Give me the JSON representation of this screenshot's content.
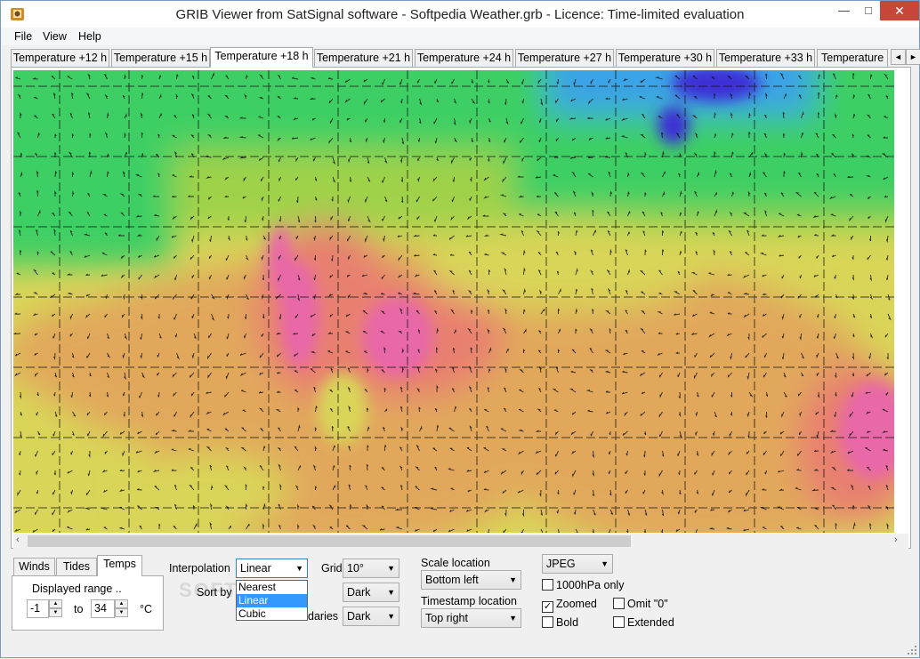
{
  "window": {
    "title": "GRIB Viewer from SatSignal software - Softpedia Weather.grb - Licence: Time-limited evaluation",
    "min_symbol": "—",
    "max_symbol": "□",
    "close_symbol": "✕"
  },
  "menu": [
    "File",
    "View",
    "Help"
  ],
  "tabs": {
    "items": [
      "Temperature +12 h",
      "Temperature +15 h",
      "Temperature +18 h",
      "Temperature +21 h",
      "Temperature +24 h",
      "Temperature +27 h",
      "Temperature +30 h",
      "Temperature +33 h",
      "Temperature"
    ],
    "active_index": 2,
    "scroll_left": "◄",
    "scroll_right": "►"
  },
  "map": {
    "description_icons": "temperature-map with wind-arrows and lat-lon grid",
    "colors": {
      "cold_deep": "#3e2dd6",
      "cold": "#3aa2e8",
      "cool": "#3ccf63",
      "mild": "#9fd24a",
      "warm": "#d9d558",
      "warmer": "#e1a85c",
      "hot": "#e88070",
      "hottest": "#e868a8"
    }
  },
  "scrollbar": {
    "left_arrow": "‹",
    "right_arrow": "›"
  },
  "bottom_tabs": {
    "items": [
      "Winds",
      "Tides",
      "Temps"
    ],
    "active_index": 2
  },
  "temps": {
    "displayed_range_label": "Displayed range ..",
    "from_value": "-1",
    "to_label": "to",
    "to_value": "34",
    "unit": "°C"
  },
  "interpolation": {
    "label": "Interpolation",
    "value": "Linear",
    "options": [
      "Nearest",
      "Linear",
      "Cubic"
    ],
    "selected_index": 1
  },
  "sort_by": {
    "label": "Sort by"
  },
  "grid": {
    "label": "Grid",
    "value": "10°"
  },
  "dark1": {
    "value": "Dark"
  },
  "boundaries": {
    "label": "daries",
    "value": "Dark"
  },
  "scale_location": {
    "label": "Scale location",
    "value": "Bottom left"
  },
  "timestamp_location": {
    "label": "Timestamp location",
    "value": "Top right"
  },
  "format": {
    "value": "JPEG"
  },
  "checkboxes": {
    "hpa": {
      "label": "1000hPa only",
      "checked": false
    },
    "zoomed": {
      "label": "Zoomed",
      "checked": true
    },
    "omit": {
      "label": "Omit \"0\"",
      "checked": false
    },
    "bold": {
      "label": "Bold",
      "checked": false
    },
    "extended": {
      "label": "Extended",
      "checked": false
    }
  },
  "watermark": "SOFTPEDIA"
}
